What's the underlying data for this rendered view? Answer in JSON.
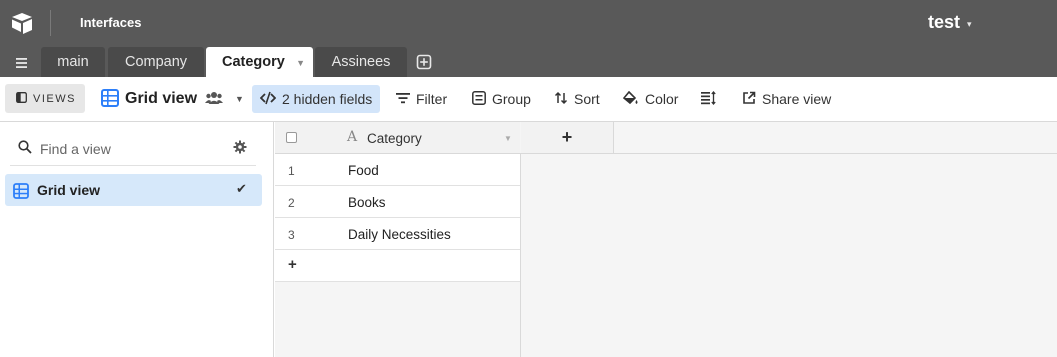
{
  "topbar": {
    "interfaces_label": "Interfaces",
    "base_name": "test",
    "base_caret": "▾"
  },
  "tabs": [
    {
      "label": "main",
      "active": false
    },
    {
      "label": "Company",
      "active": false
    },
    {
      "label": "Category",
      "active": true
    },
    {
      "label": "Assinees",
      "active": false
    }
  ],
  "viewbar": {
    "views_label": "VIEWS",
    "view_name": "Grid view",
    "hidden_fields": "2 hidden fields",
    "filter": "Filter",
    "group": "Group",
    "sort": "Sort",
    "color": "Color",
    "share_view": "Share view"
  },
  "sidebar": {
    "search_placeholder": "Find a view",
    "views": [
      {
        "label": "Grid view",
        "selected": true,
        "check": "✔"
      }
    ]
  },
  "grid": {
    "field_icon": "A",
    "columns": [
      "Category"
    ],
    "add_field": "+",
    "rows": [
      {
        "num": "1",
        "category": "Food"
      },
      {
        "num": "2",
        "category": "Books"
      },
      {
        "num": "3",
        "category": "Daily Necessities"
      }
    ],
    "add_row": "+"
  },
  "colors": {
    "topbar_bg": "#595959",
    "tab_bg": "#4a4a4a",
    "accent_blue": "#2d7ff9",
    "hidden_fields_bg": "#d3e5fa",
    "selected_view_bg": "#d6e8fa"
  }
}
